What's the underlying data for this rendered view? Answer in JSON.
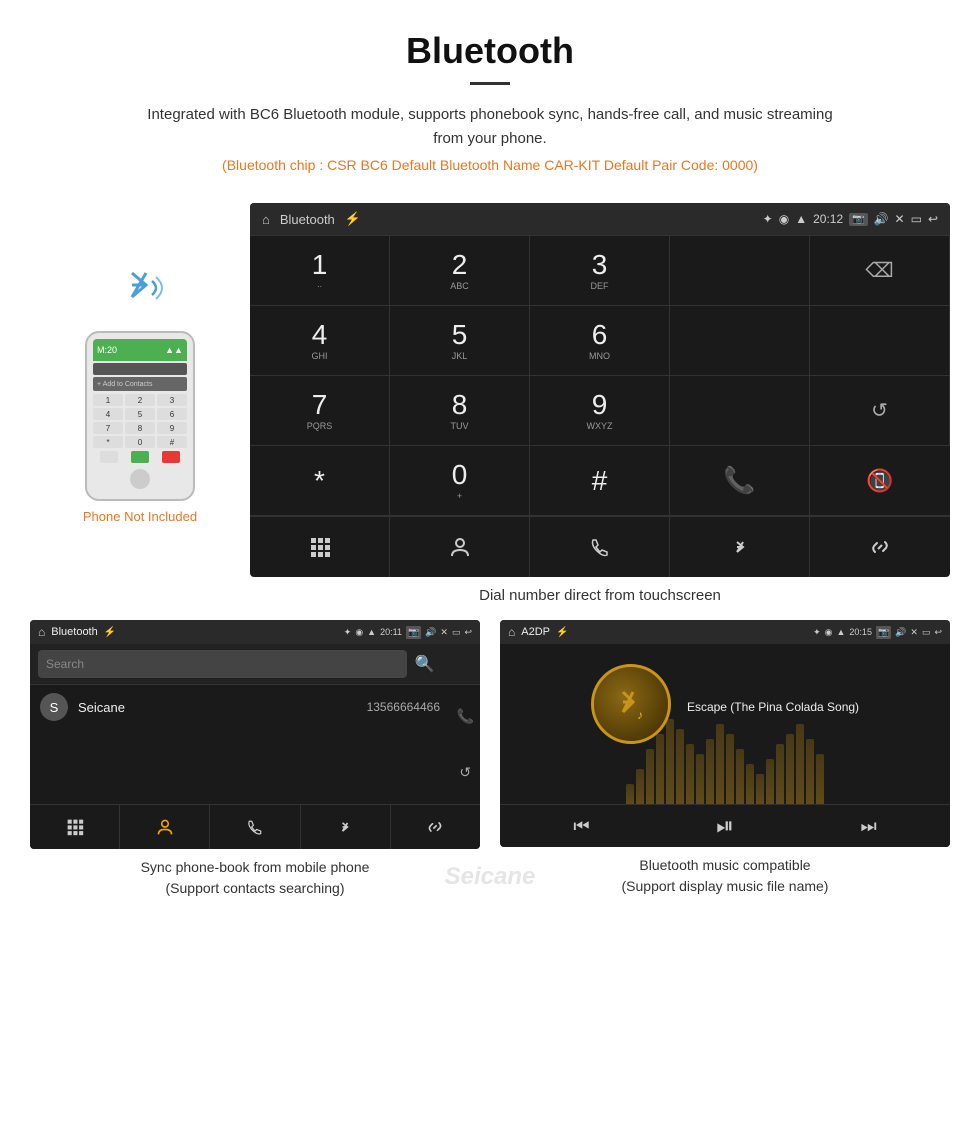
{
  "header": {
    "title": "Bluetooth",
    "description": "Integrated with BC6 Bluetooth module, supports phonebook sync, hands-free call, and music streaming from your phone.",
    "specs": "(Bluetooth chip : CSR BC6    Default Bluetooth Name CAR-KIT    Default Pair Code: 0000)"
  },
  "phone_label": "Phone Not Included",
  "big_screen": {
    "status_bar": {
      "home_icon": "⌂",
      "title": "Bluetooth",
      "usb_icon": "⚡",
      "bt_icon": "✦",
      "location_icon": "◉",
      "signal_icon": "▲",
      "time": "20:12",
      "camera_icon": "📷",
      "volume_icon": "🔊",
      "close_icon": "✕",
      "window_icon": "▭",
      "back_icon": "↩"
    },
    "dialpad": [
      {
        "number": "1",
        "letters": "∙∙",
        "row": 0,
        "col": 0
      },
      {
        "number": "2",
        "letters": "ABC",
        "row": 0,
        "col": 1
      },
      {
        "number": "3",
        "letters": "DEF",
        "row": 0,
        "col": 2
      },
      {
        "number": "",
        "letters": "",
        "row": 0,
        "col": 3
      },
      {
        "number": "⌫",
        "letters": "",
        "row": 0,
        "col": 4,
        "type": "backspace"
      },
      {
        "number": "4",
        "letters": "GHI",
        "row": 1,
        "col": 0
      },
      {
        "number": "5",
        "letters": "JKL",
        "row": 1,
        "col": 1
      },
      {
        "number": "6",
        "letters": "MNO",
        "row": 1,
        "col": 2
      },
      {
        "number": "",
        "letters": "",
        "row": 1,
        "col": 3
      },
      {
        "number": "",
        "letters": "",
        "row": 1,
        "col": 4
      },
      {
        "number": "7",
        "letters": "PQRS",
        "row": 2,
        "col": 0
      },
      {
        "number": "8",
        "letters": "TUV",
        "row": 2,
        "col": 1
      },
      {
        "number": "9",
        "letters": "WXYZ",
        "row": 2,
        "col": 2
      },
      {
        "number": "",
        "letters": "",
        "row": 2,
        "col": 3
      },
      {
        "number": "↺",
        "letters": "",
        "row": 2,
        "col": 4,
        "type": "refresh"
      },
      {
        "number": "*",
        "letters": "",
        "row": 3,
        "col": 0
      },
      {
        "number": "0",
        "letters": "+",
        "row": 3,
        "col": 1
      },
      {
        "number": "#",
        "letters": "",
        "row": 3,
        "col": 2
      },
      {
        "number": "call",
        "letters": "",
        "row": 3,
        "col": 3,
        "type": "call"
      },
      {
        "number": "end",
        "letters": "",
        "row": 3,
        "col": 4,
        "type": "end"
      }
    ],
    "toolbar": [
      {
        "icon": "⊞",
        "type": "dialpad"
      },
      {
        "icon": "👤",
        "type": "contacts"
      },
      {
        "icon": "📞",
        "type": "phone"
      },
      {
        "icon": "✦",
        "type": "bluetooth"
      },
      {
        "icon": "🔗",
        "type": "link"
      }
    ]
  },
  "caption_main": "Dial number direct from touchscreen",
  "phonebook_screen": {
    "status_bar_title": "Bluetooth",
    "time": "20:11",
    "search_placeholder": "Search",
    "contacts": [
      {
        "initial": "S",
        "name": "Seicane",
        "number": "13566664466"
      }
    ],
    "toolbar": [
      {
        "icon": "⊞",
        "type": "dialpad"
      },
      {
        "icon": "👤",
        "type": "contacts",
        "color": "yellow"
      },
      {
        "icon": "📞",
        "type": "phone"
      },
      {
        "icon": "✦",
        "type": "bluetooth"
      },
      {
        "icon": "🔗",
        "type": "link"
      }
    ]
  },
  "music_screen": {
    "status_bar_title": "A2DP",
    "time": "20:15",
    "song_title": "Escape (The Pina Colada Song)",
    "eq_bars": [
      20,
      35,
      55,
      70,
      85,
      75,
      60,
      50,
      65,
      80,
      70,
      55,
      40,
      30,
      45,
      60,
      70,
      80,
      65,
      50
    ],
    "controls": [
      "⏮",
      "⏯",
      "⏭"
    ]
  },
  "caption_phonebook": "Sync phone-book from mobile phone\n(Support contacts searching)",
  "caption_music": "Bluetooth music compatible\n(Support display music file name)",
  "seicane_watermark": "Seicane",
  "colors": {
    "accent": "#e87722",
    "green": "#4caf50",
    "red": "#e53935",
    "dark_bg": "#1a1a1a",
    "statusbar_bg": "#2a2a2a"
  }
}
